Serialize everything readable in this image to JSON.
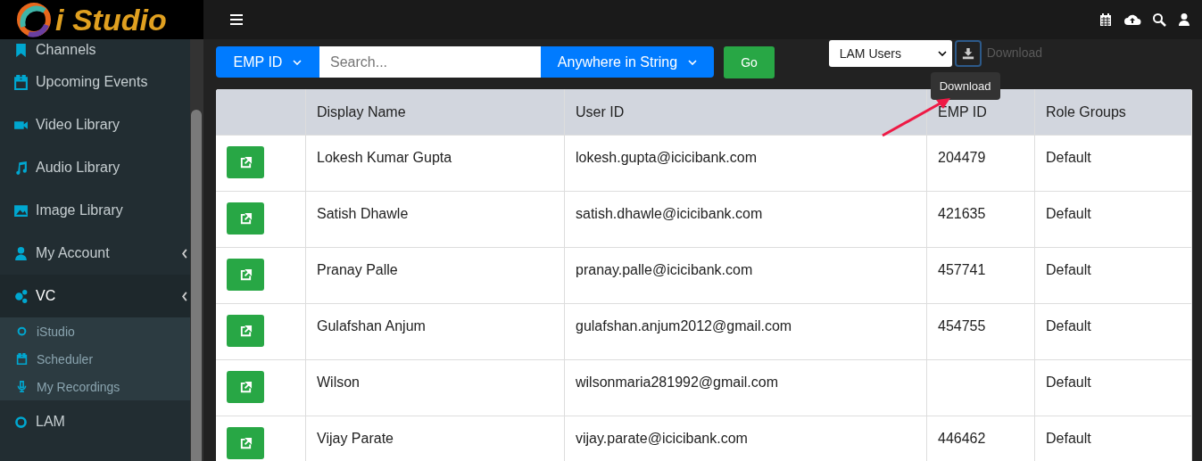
{
  "logo": {
    "text": "i Studio"
  },
  "sidebar": {
    "items": [
      {
        "label": "Channels",
        "expandable": false,
        "selected": false
      },
      {
        "label": "Upcoming Events",
        "expandable": false,
        "selected": false
      },
      {
        "label": "Video Library",
        "expandable": false,
        "selected": false
      },
      {
        "label": "Audio Library",
        "expandable": false,
        "selected": false
      },
      {
        "label": "Image Library",
        "expandable": false,
        "selected": false
      },
      {
        "label": "My Account",
        "expandable": true,
        "selected": false
      },
      {
        "label": "VC",
        "expandable": true,
        "selected": true,
        "children": [
          {
            "label": "iStudio"
          },
          {
            "label": "Scheduler"
          },
          {
            "label": "My Recordings"
          }
        ]
      },
      {
        "label": "LAM",
        "expandable": false,
        "selected": false
      }
    ]
  },
  "search_bar": {
    "field_select": "EMP ID",
    "placeholder": "Search...",
    "match_select": "Anywhere in String",
    "go_button": "Go"
  },
  "export": {
    "select": "LAM Users",
    "button_label": "Download",
    "tooltip": "Download"
  },
  "table": {
    "columns": [
      "",
      "Display Name",
      "User ID",
      "EMP ID",
      "Role Groups"
    ],
    "rows": [
      {
        "display_name": "Lokesh Kumar Gupta",
        "user_id": "lokesh.gupta@icicibank.com",
        "emp_id": "204479",
        "role_groups": "Default"
      },
      {
        "display_name": "Satish Dhawle",
        "user_id": "satish.dhawle@icicibank.com",
        "emp_id": "421635",
        "role_groups": "Default"
      },
      {
        "display_name": "Pranay Palle",
        "user_id": "pranay.palle@icicibank.com",
        "emp_id": "457741",
        "role_groups": "Default"
      },
      {
        "display_name": "Gulafshan Anjum",
        "user_id": "gulafshan.anjum2012@gmail.com",
        "emp_id": "454755",
        "role_groups": "Default"
      },
      {
        "display_name": "Wilson",
        "user_id": "wilsonmaria281992@gmail.com",
        "emp_id": "",
        "role_groups": "Default"
      },
      {
        "display_name": "Vijay Parate",
        "user_id": "vijay.parate@icicibank.com",
        "emp_id": "446462",
        "role_groups": "Default"
      }
    ]
  }
}
